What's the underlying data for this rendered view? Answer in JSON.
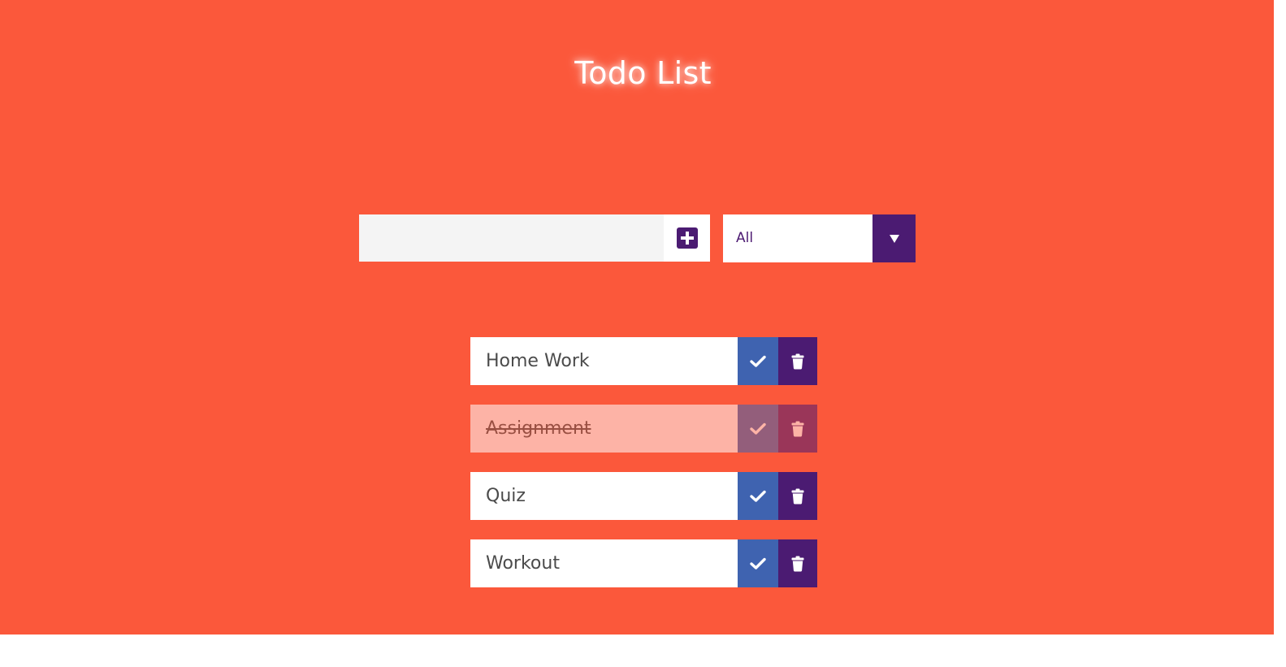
{
  "header": {
    "title": "Todo List"
  },
  "add_form": {
    "input_value": "",
    "input_placeholder": "",
    "add_icon": "plus-square-icon"
  },
  "filter": {
    "selected": "All",
    "arrow_icon": "caret-down-icon"
  },
  "todos": [
    {
      "text": "Home Work",
      "completed": false
    },
    {
      "text": "Assignment",
      "completed": true
    },
    {
      "text": "Quiz",
      "completed": false
    },
    {
      "text": "Workout",
      "completed": false
    }
  ],
  "colors": {
    "background": "#fb583b",
    "accent_purple": "#4b1b72",
    "check_blue": "#3f63b0",
    "input_bg": "#f4f4f4"
  }
}
